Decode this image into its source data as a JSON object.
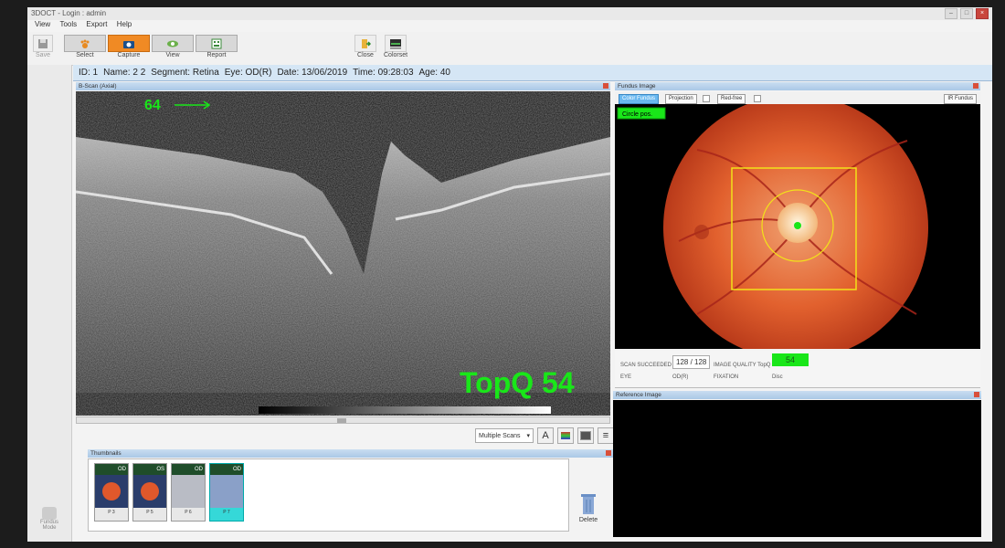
{
  "window": {
    "title": "3DOCT - Login : admin"
  },
  "menu": [
    "View",
    "Tools",
    "Export",
    "Help"
  ],
  "toolbar": {
    "save_label": "Save",
    "select_label": "Select",
    "capture_label": "Capture",
    "view_label": "View",
    "report_label": "Report",
    "close_label": "Close",
    "colorset_label": "Colorset"
  },
  "patient": {
    "id": "ID: 1",
    "name": "Name: 2 2",
    "segment": "Segment: Retina",
    "eye": "Eye: OD(R)",
    "date": "Date: 13/06/2019",
    "time": "Time: 09:28:03",
    "age": "Age: 40"
  },
  "bscan": {
    "panel_title": "B-Scan (Axial)",
    "frame_number": "64",
    "quality_text": "TopQ 54",
    "view_mode": "Multiple Scans"
  },
  "thumbnails": {
    "panel_title": "Thumbnails",
    "items": [
      {
        "eye": "OD",
        "label": "P 3"
      },
      {
        "eye": "OS",
        "label": "P 5"
      },
      {
        "eye": "OD",
        "label": "P 6"
      },
      {
        "eye": "OD",
        "label": "P 7"
      }
    ],
    "delete_label": "Delete"
  },
  "fundus": {
    "panel_title": "Fundus Image",
    "tabs": [
      "Color Fundus",
      "Projection",
      "Red-free"
    ],
    "ir_label": "IR Fundus",
    "circle_pos_label": "Circle pos.",
    "scan_succeeded_label": "SCAN SUCCEEDED",
    "scan_count": "128 / 128",
    "image_quality_label": "IMAGE QUALITY TopQ",
    "image_quality_value": "54",
    "eye_label": "EYE",
    "eye_value": "OD(R)",
    "fixation_label": "FIXATION",
    "fixation_value": "Disc"
  },
  "reference": {
    "panel_title": "Reference Image"
  },
  "sidebar": {
    "fundus_mode_label": "Fundus Mode"
  },
  "colors": {
    "quality_green": "#19e619",
    "capture_orange": "#f08a24",
    "info_bar": "#d5e6f5"
  }
}
